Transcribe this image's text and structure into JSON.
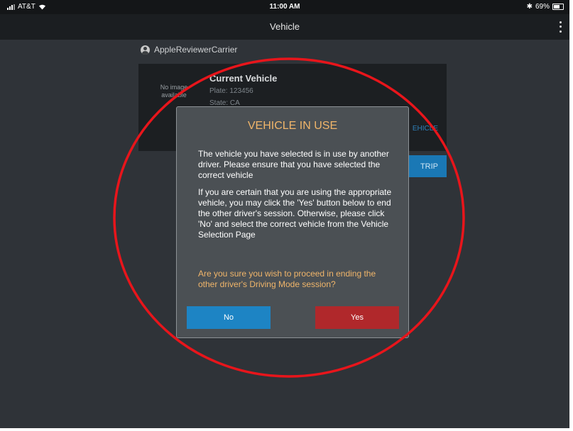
{
  "status_bar": {
    "carrier": "AT&T",
    "time": "11:00 AM",
    "bluetooth": "✱",
    "battery": "69%"
  },
  "nav": {
    "title": "Vehicle"
  },
  "account": {
    "name": "AppleReviewerCarrier"
  },
  "vehicle": {
    "no_image": "No image available",
    "title": "Current Vehicle",
    "plate": "Plate: 123456",
    "state": "State: CA",
    "change_partial": "EHICLE",
    "trip_partial": "TRIP"
  },
  "dialog": {
    "title": "VEHICLE IN USE",
    "message_1": "The vehicle you have selected is in use by another driver.  Please ensure that you have selected the correct vehicle",
    "message_2": "If you are certain that you are using the appropriate vehicle, you may click the 'Yes' button below to end the other driver's session.  Otherwise, please click 'No' and select the correct vehicle from the Vehicle Selection Page",
    "question": "Are you sure you wish to proceed in ending the other driver's Driving Mode session?",
    "no_label": "No",
    "yes_label": "Yes"
  },
  "colors": {
    "accent_orange": "#f0b56a",
    "no_button": "#1d84c4",
    "yes_button": "#b0282b",
    "annotation_circle": "#e8151b"
  },
  "icons": [
    "wifi-icon",
    "signal-icon",
    "bluetooth-icon",
    "battery-icon",
    "more-vertical-icon",
    "user-icon"
  ]
}
